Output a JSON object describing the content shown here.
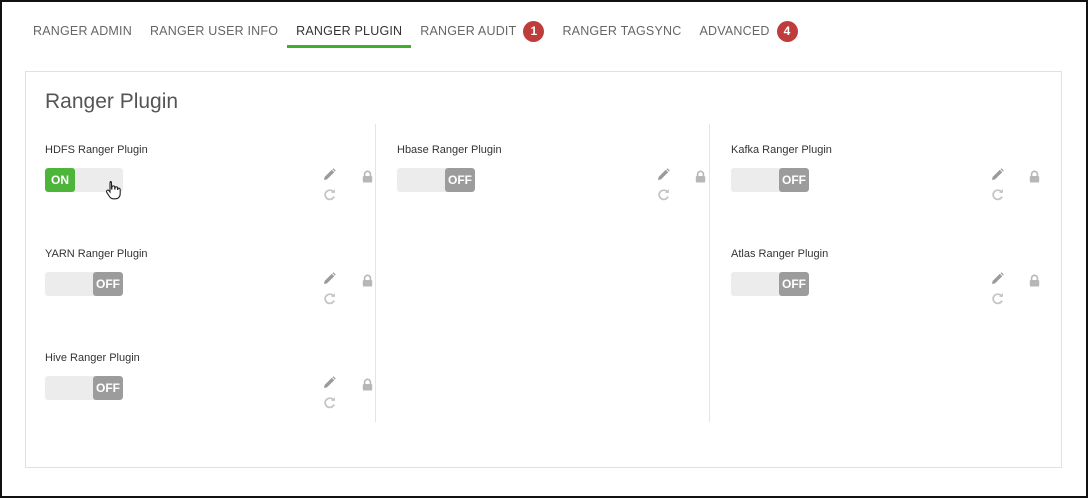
{
  "tabs": [
    {
      "label": "RANGER ADMIN",
      "badge": null,
      "active": false
    },
    {
      "label": "RANGER USER INFO",
      "badge": null,
      "active": false
    },
    {
      "label": "RANGER PLUGIN",
      "badge": null,
      "active": true
    },
    {
      "label": "RANGER AUDIT",
      "badge": "1",
      "active": false
    },
    {
      "label": "RANGER TAGSYNC",
      "badge": null,
      "active": false
    },
    {
      "label": "ADVANCED",
      "badge": "4",
      "active": false
    }
  ],
  "panel": {
    "title": "Ranger Plugin"
  },
  "plugins": {
    "hdfs": {
      "label": "HDFS Ranger Plugin",
      "state": "ON"
    },
    "yarn": {
      "label": "YARN Ranger Plugin",
      "state": "OFF"
    },
    "hive": {
      "label": "Hive Ranger Plugin",
      "state": "OFF"
    },
    "hbase": {
      "label": "Hbase Ranger Plugin",
      "state": "OFF"
    },
    "kafka": {
      "label": "Kafka Ranger Plugin",
      "state": "OFF"
    },
    "atlas": {
      "label": "Atlas Ranger Plugin",
      "state": "OFF"
    }
  },
  "colors": {
    "accent": "#3fae2a",
    "on": "#4cb53a",
    "off": "#9c9c9c",
    "badge": "#be3c3c"
  },
  "icons": {
    "edit": "pencil-icon",
    "undo": "refresh-icon",
    "lock": "lock-icon",
    "cursor": "hand-pointer-icon"
  }
}
